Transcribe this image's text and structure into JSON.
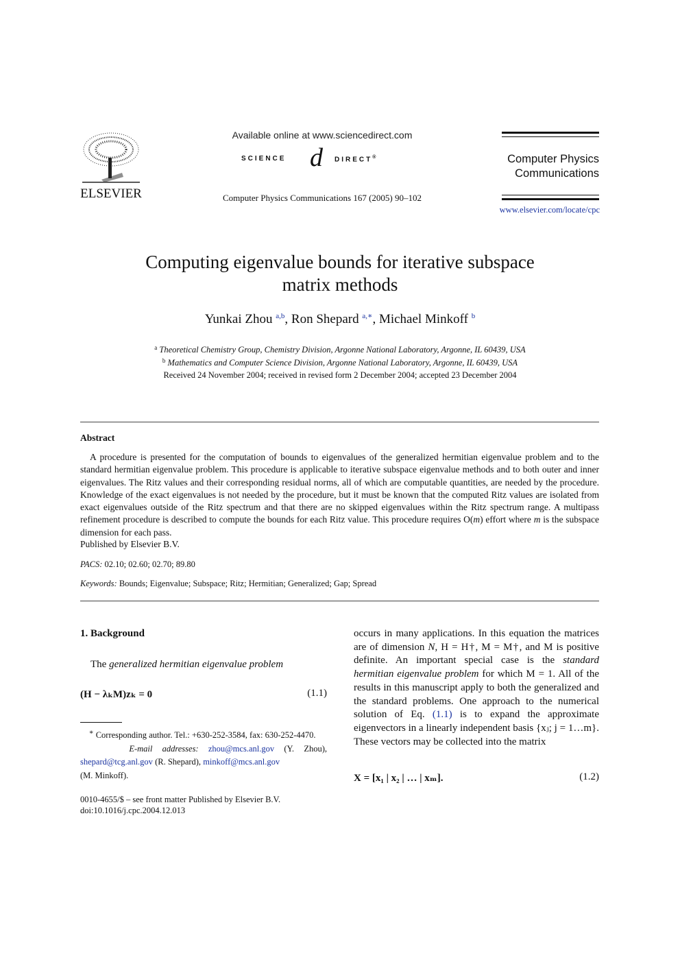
{
  "header": {
    "publisher_logo_text": "ELSEVIER",
    "available_online": "Available online at www.sciencedirect.com",
    "sciencedirect": {
      "left": "SCIENCE",
      "at": "d",
      "right": "DIRECT",
      "reg": "®"
    },
    "journal_reference": "Computer Physics Communications 167 (2005) 90–102",
    "journal_name_line1": "Computer Physics",
    "journal_name_line2": "Communications",
    "journal_url": "www.elsevier.com/locate/cpc"
  },
  "article": {
    "title_line1": "Computing eigenvalue bounds for iterative subspace",
    "title_line2": "matrix methods",
    "authors": [
      {
        "name": "Yunkai Zhou",
        "affil": "a,b",
        "sep": ", "
      },
      {
        "name": "Ron Shepard",
        "affil": "a,∗",
        "sep": ", "
      },
      {
        "name": "Michael Minkoff",
        "affil": "b",
        "sep": ""
      }
    ],
    "affiliations": [
      {
        "label": "a",
        "text": "Theoretical Chemistry Group, Chemistry Division, Argonne National Laboratory, Argonne, IL 60439, USA"
      },
      {
        "label": "b",
        "text": "Mathematics and Computer Science Division, Argonne National Laboratory, Argonne, IL 60439, USA"
      }
    ],
    "dates": "Received 24 November 2004; received in revised form 2 December 2004; accepted 23 December 2004"
  },
  "abstract": {
    "heading": "Abstract",
    "text": "A procedure is presented for the computation of bounds to eigenvalues of the generalized hermitian eigenvalue problem and to the standard hermitian eigenvalue problem. This procedure is applicable to iterative subspace eigenvalue methods and to both outer and inner eigenvalues. The Ritz values and their corresponding residual norms, all of which are computable quantities, are needed by the procedure. Knowledge of the exact eigenvalues is not needed by the procedure, but it must be known that the computed Ritz values are isolated from exact eigenvalues outside of the Ritz spectrum and that there are no skipped eigenvalues within the Ritz spectrum range. A multipass refinement procedure is described to compute the bounds for each Ritz value. This procedure requires O(",
    "text_m": "m",
    "text_mid": ") effort where ",
    "text_m2": "m",
    "text_end": " is the subspace dimension for each pass.",
    "published_by": "Published by Elsevier B.V.",
    "pacs_label": "PACS:",
    "pacs": "02.10; 02.60; 02.70; 89.80",
    "keywords_label": "Keywords:",
    "keywords": "Bounds; Eigenvalue; Subspace; Ritz; Hermitian; Generalized; Gap; Spread"
  },
  "section1": {
    "heading": "1.  Background",
    "intro_plain": "The ",
    "intro_italic": "generalized hermitian eigenvalue problem",
    "eq_1_1": "(H − λₖM)zₖ = 0",
    "eq_1_1_num": "(1.1)",
    "col2": {
      "p1a": "occurs in many applications. In this equation the matrices are of dimension ",
      "N": "N",
      "p1b": ", H = H†, M = M†, and M is positive definite. An important special case is the ",
      "italic": "standard hermitian eigenvalue problem",
      "p1c": " for which M = 1. All of the results in this manuscript apply to both the generalized and the standard problems. One approach to the numerical solution of Eq. ",
      "eq_ref": "(1.1)",
      "p1d": " is to expand the approximate eigenvectors in a linearly independent basis {xⱼ;  j = 1…m}. These vectors may be collected into the matrix"
    },
    "eq_1_2": "X = [x₁ | x₂ | … | xₘ].",
    "eq_1_2_num": "(1.2)"
  },
  "footnotes": {
    "star": "∗",
    "corresponding": " Corresponding author. Tel.: +630-252-3584, fax: 630-252-4470.",
    "email_label": "E-mail addresses:",
    "emails": [
      {
        "addr": "zhou@mcs.anl.gov",
        "who": " (Y. Zhou),"
      },
      {
        "addr": "shepard@tcg.anl.gov",
        "who": " (R. Shepard), "
      },
      {
        "addr": "minkoff@mcs.anl.gov",
        "who": " (M. Minkoff)."
      }
    ],
    "issn": "0010-4655/$ – see front matter  Published by Elsevier B.V.",
    "doi": "doi:10.1016/j.cpc.2004.12.013"
  },
  "colors": {
    "link": "#1a33a0",
    "text": "#111111"
  }
}
